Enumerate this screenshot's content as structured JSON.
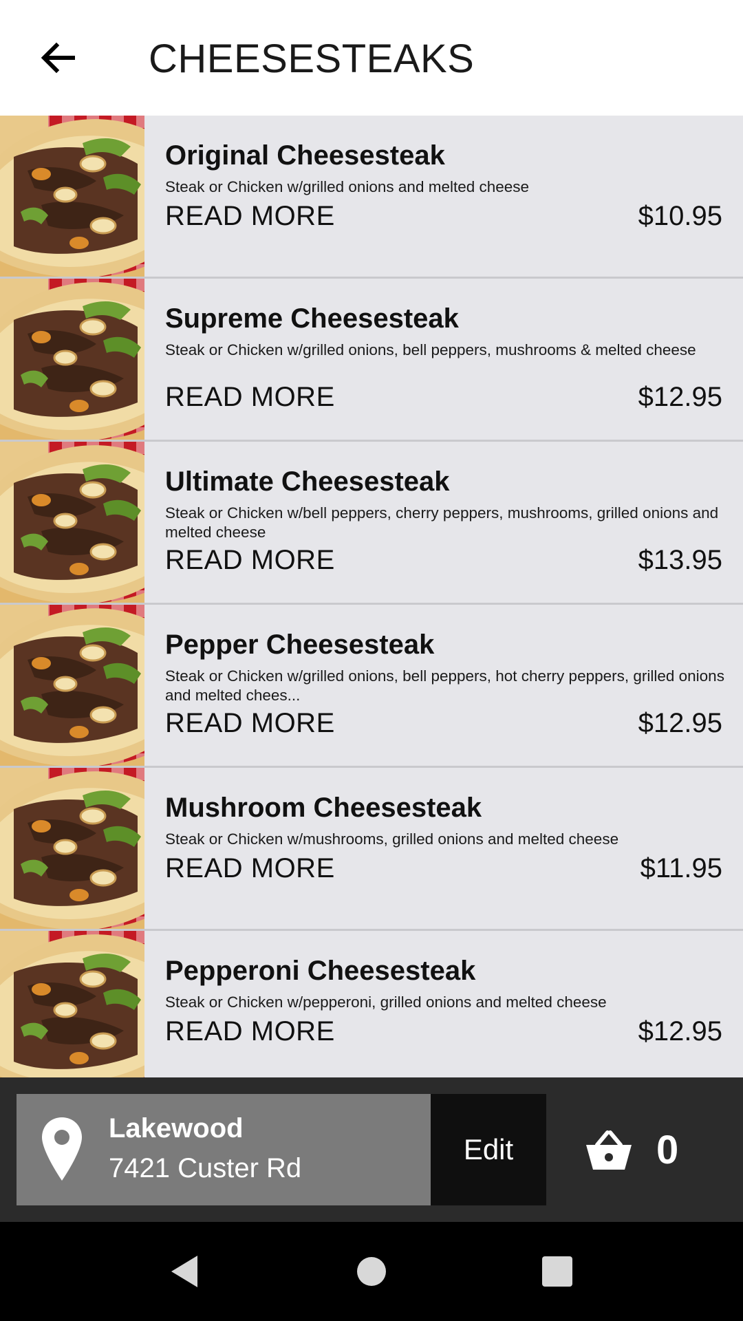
{
  "header": {
    "title": "CHEESESTEAKS",
    "back_icon": "arrow-left-icon"
  },
  "menu": {
    "read_more_label": "READ MORE",
    "items": [
      {
        "name": "Original Cheesesteak",
        "description": "Steak or Chicken w/grilled onions and melted cheese",
        "price": "$10.95"
      },
      {
        "name": "Supreme Cheesesteak",
        "description": "Steak or Chicken w/grilled onions, bell peppers, mushrooms & melted cheese",
        "price": "$12.95"
      },
      {
        "name": "Ultimate Cheesesteak",
        "description": "Steak or Chicken w/bell peppers, cherry peppers, mushrooms, grilled onions and melted cheese",
        "price": "$13.95"
      },
      {
        "name": "Pepper Cheesesteak",
        "description": "Steak or Chicken w/grilled onions, bell peppers, hot cherry peppers, grilled onions and melted chees...",
        "price": "$12.95"
      },
      {
        "name": "Mushroom Cheesesteak",
        "description": "Steak or Chicken w/mushrooms, grilled onions and melted cheese",
        "price": "$11.95"
      },
      {
        "name": "Pepperoni Cheesesteak",
        "description": "Steak or Chicken w/pepperoni, grilled onions and melted cheese",
        "price": "$12.95"
      }
    ]
  },
  "bottom_bar": {
    "location_name": "Lakewood",
    "location_address": "7421 Custer Rd",
    "edit_label": "Edit",
    "cart_count": "0",
    "pin_icon": "map-pin-icon",
    "cart_icon": "shopping-basket-icon"
  },
  "system_nav": {
    "icons": [
      "back-triangle-icon",
      "home-circle-icon",
      "recents-square-icon"
    ]
  },
  "colors": {
    "list_background": "#e6e6ea",
    "bottom_bar": "#2b2b2b",
    "location_box": "#7b7b7b",
    "edit_button": "#0f0f0f",
    "nav_bar": "#000000"
  }
}
